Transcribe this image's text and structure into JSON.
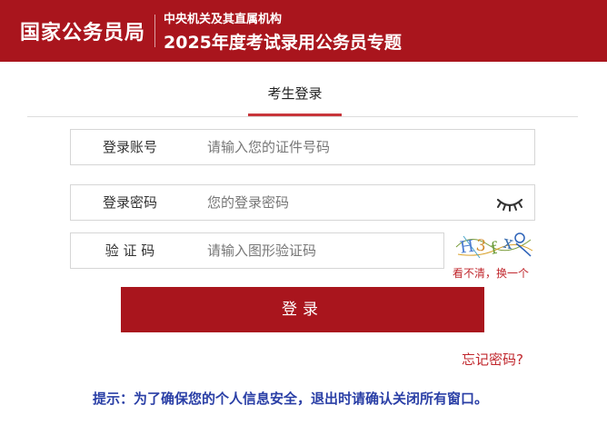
{
  "header": {
    "brand": "国家公务员局",
    "subtitle_top": "中央机关及其直属机构",
    "subtitle_main": "2025年度考试录用公务员专题"
  },
  "tabs": [
    {
      "label": "考生登录",
      "active": true
    }
  ],
  "form": {
    "account": {
      "label": "登录账号",
      "placeholder": "请输入您的证件号码",
      "value": ""
    },
    "password": {
      "label": "登录密码",
      "placeholder": "您的登录密码",
      "value": "",
      "toggle_icon": "eye-closed-icon"
    },
    "captcha": {
      "label": "验 证 码",
      "placeholder": "请输入图形验证码",
      "value": "",
      "image_text": "H3fx",
      "refresh_label": "看不清，换一个"
    }
  },
  "login_button": "登录",
  "forgot_password": "忘记密码?",
  "tip": "提示：为了确保您的个人信息安全，退出时请确认关闭所有窗口。",
  "colors": {
    "brand_red": "#a9151d",
    "link_red": "#c0272d",
    "tip_blue": "#2a3fa6"
  }
}
